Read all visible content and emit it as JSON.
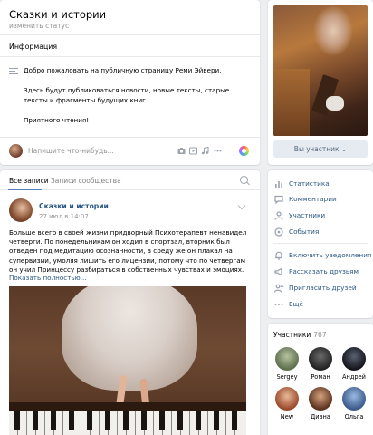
{
  "header": {
    "title": "Сказки и истории",
    "status": "изменить статус",
    "info_heading": "Информация",
    "info_paragraphs": [
      "Добро пожаловать на публичную страницу Реми Эйвери.",
      "Здесь будут публиковаться новости, новые тексты, старые тексты и фрагменты будущих книг.",
      "Приятного чтения!"
    ]
  },
  "composer": {
    "placeholder": "Напишите что-нибудь..."
  },
  "cover": {
    "member_button": "Вы участник ⌄"
  },
  "feed": {
    "tabs": [
      "Все записи",
      "Записи сообщества"
    ],
    "active_tab": 0
  },
  "post": {
    "author": "Сказки и истории",
    "date": "27 июл в 14:07",
    "text": "Больше всего в своей жизни придворный Психотерапевт ненавидел четверги. По понедельникам он ходил в спортзал, вторник был отведен под медитацию осознанности, в среду же он плакал на супервизии, умоляя лишить его лицензии, потому что по четвергам он учил Принцессу разбираться в собственных чувствах и эмоциях.",
    "more_link": "Показать полностью..."
  },
  "menu": {
    "items": [
      {
        "label": "Статистика",
        "icon": "chart-icon"
      },
      {
        "label": "Комментарии",
        "icon": "comments-icon"
      },
      {
        "label": "Участники",
        "icon": "members-icon"
      },
      {
        "label": "События",
        "icon": "events-icon"
      },
      {
        "label": "Включить уведомления",
        "icon": "bell-icon"
      },
      {
        "label": "Рассказать друзьям",
        "icon": "megaphone-icon"
      },
      {
        "label": "Пригласить друзей",
        "icon": "invite-icon"
      },
      {
        "label": "Ещё",
        "icon": "more-icon"
      }
    ]
  },
  "members": {
    "heading": "Участники",
    "count": "767",
    "people": [
      {
        "name": "Sergey",
        "color": "#7a8f6a"
      },
      {
        "name": "Роман",
        "color": "#3a3a3a"
      },
      {
        "name": "Андрей",
        "color": "#2b2f3a"
      },
      {
        "name": "New",
        "color": "#c47a5a"
      },
      {
        "name": "Дивна",
        "color": "#9a6a4a"
      },
      {
        "name": "Ольга",
        "color": "#5a7ab0"
      }
    ]
  }
}
